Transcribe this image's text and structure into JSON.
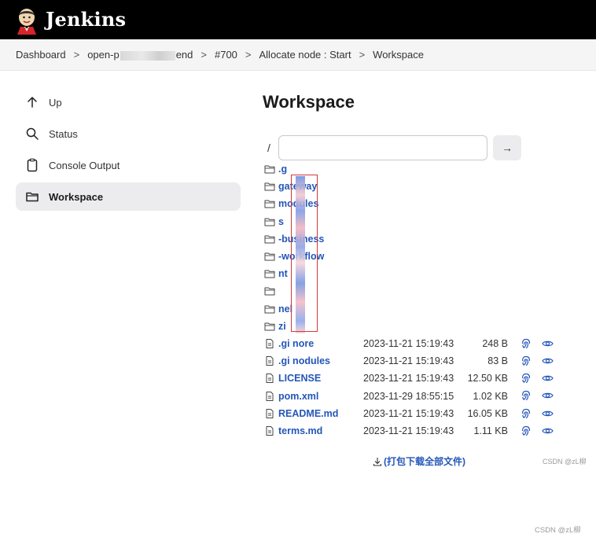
{
  "header": {
    "brand": "Jenkins",
    "logo_icon": "jenkins-butler-logo"
  },
  "breadcrumb": [
    {
      "label": "Dashboard"
    },
    {
      "label_pre": "open-p",
      "label_post": "end"
    },
    {
      "label": "#700"
    },
    {
      "label": "Allocate node : Start"
    },
    {
      "label": "Workspace"
    }
  ],
  "breadcrumb_sep": ">",
  "sidebar": {
    "items": [
      {
        "label": "Up",
        "icon": "arrow-up-icon",
        "active": false
      },
      {
        "label": "Status",
        "icon": "search-icon",
        "active": false
      },
      {
        "label": "Console Output",
        "icon": "clipboard-icon",
        "active": false
      },
      {
        "label": "Workspace",
        "icon": "folder-icon",
        "active": true
      }
    ]
  },
  "main": {
    "title": "Workspace",
    "path_slash": "/",
    "path_value": "",
    "go_label": "→",
    "folders": [
      {
        "name": ".g"
      },
      {
        "name": "gateway"
      },
      {
        "name": "modules"
      },
      {
        "name": "s"
      },
      {
        "name": "-business"
      },
      {
        "name": "-workflow"
      },
      {
        "name": "nt"
      },
      {
        "name": ""
      },
      {
        "name": "nel"
      },
      {
        "name": "zi"
      }
    ],
    "files": [
      {
        "name": ".gitignore",
        "name_shown": ".gi  nore",
        "date": "2023-11-21 15:19:43",
        "size": "248 B"
      },
      {
        "name": ".gitmodules",
        "name_shown": ".gi  nodules",
        "date": "2023-11-21 15:19:43",
        "size": "83 B"
      },
      {
        "name": "LICENSE",
        "name_shown": "LICENSE",
        "date": "2023-11-21 15:19:43",
        "size": "12.50 KB"
      },
      {
        "name": "pom.xml",
        "name_shown": "pom.xml",
        "date": "2023-11-29 18:55:15",
        "size": "1.02 KB"
      },
      {
        "name": "README.md",
        "name_shown": "README.md",
        "date": "2023-11-21 15:19:43",
        "size": "16.05 KB"
      },
      {
        "name": "terms.md",
        "name_shown": "terms.md",
        "date": "2023-11-21 15:19:43",
        "size": "1.11 KB"
      }
    ],
    "download_all": "(打包下载全部文件)"
  },
  "watermark": "CSDN @zL柳",
  "colors": {
    "link": "#2456b8",
    "header_bg": "#000000",
    "active_bg": "#ececef"
  }
}
